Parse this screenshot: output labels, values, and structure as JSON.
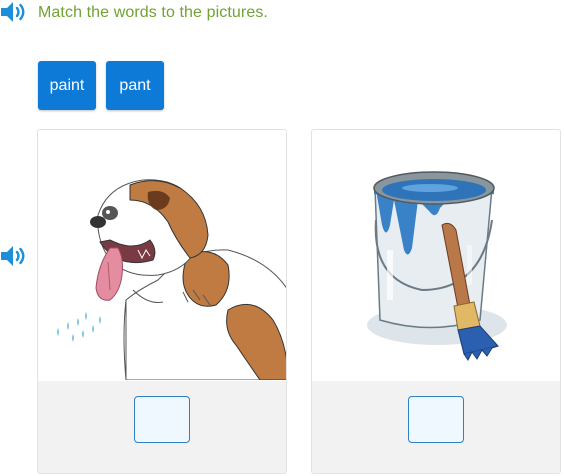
{
  "instruction": {
    "text": "Match the words to the pictures.",
    "color": "#70a234"
  },
  "word_tiles": [
    {
      "label": "paint"
    },
    {
      "label": "pant"
    }
  ],
  "pictures": [
    {
      "subject": "panting dog",
      "drop_value": ""
    },
    {
      "subject": "paint can and brush",
      "drop_value": ""
    }
  ],
  "icons": {
    "instruction_audio": "speaker-icon",
    "pictures_audio": "speaker-icon"
  },
  "colors": {
    "accent": "#0e7ad8",
    "tile_text": "#ffffff",
    "drop_border": "#2f7fc4",
    "drop_fill": "#eef8fe",
    "speaker": "#1c8fd8"
  }
}
